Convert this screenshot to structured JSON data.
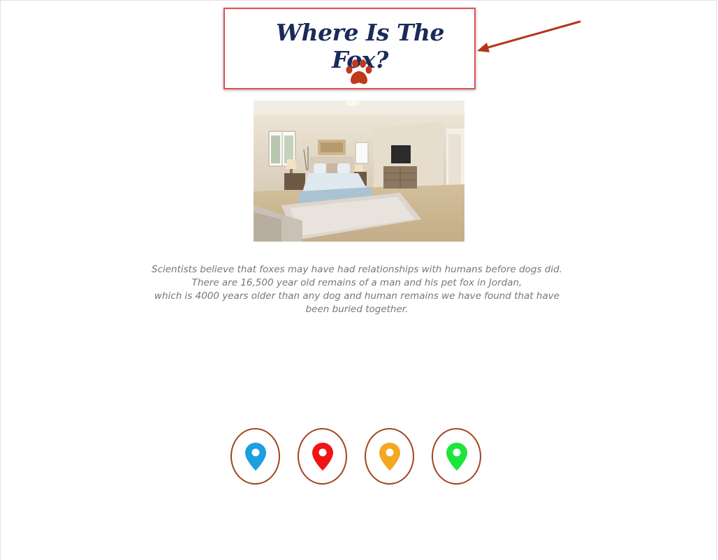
{
  "header": {
    "title": "Where Is The Fox?"
  },
  "caption": {
    "lines": [
      "Scientists believe that foxes may have had relationships with humans before dogs did.",
      "There are 16,500 year old remains of a man and his pet fox in Jordan,",
      "which is 4000 years older than any dog and human remains we have found that have",
      "been buried together."
    ]
  },
  "colors": {
    "title": "#1a2a5a",
    "paw": "#c0391b",
    "arrow": "#b5361c",
    "highlight": "#e05252",
    "pin_border": "#a0451e"
  },
  "pins": [
    {
      "icon": "map-pin-icon",
      "color": "#1a9fe0"
    },
    {
      "icon": "map-pin-icon",
      "color": "#f01414"
    },
    {
      "icon": "map-pin-icon",
      "color": "#f5a623"
    },
    {
      "icon": "map-pin-icon",
      "color": "#1de53c"
    }
  ],
  "image": {
    "icon": "bedroom-photo"
  }
}
